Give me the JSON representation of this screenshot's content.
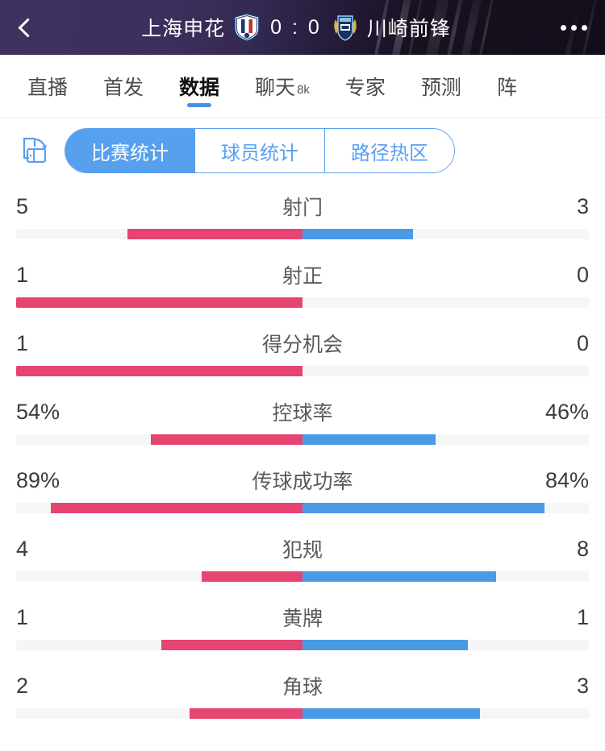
{
  "header": {
    "back_icon": "back-chevron-icon",
    "home_team": "上海申花",
    "away_team": "川崎前锋",
    "score": "0 : 0",
    "home_crest_icon": "shanghai-shenhua-crest-icon",
    "away_crest_icon": "kawasaki-frontale-crest-icon",
    "more_icon": "more-options-icon",
    "bg_color": "#2f2447",
    "bg_dark": "#130d1a"
  },
  "tabs": [
    {
      "label": "直播",
      "badge": "",
      "active": false
    },
    {
      "label": "首发",
      "badge": "",
      "active": false
    },
    {
      "label": "数据",
      "badge": "",
      "active": true
    },
    {
      "label": "聊天",
      "badge": "8k",
      "active": false
    },
    {
      "label": "专家",
      "badge": "",
      "active": false
    },
    {
      "label": "预测",
      "badge": "",
      "active": false
    },
    {
      "label": "阵",
      "badge": "",
      "active": false
    }
  ],
  "toolbar": {
    "rotate_icon": "screen-rotate-icon",
    "segments": [
      {
        "label": "比赛统计",
        "active": true
      },
      {
        "label": "球员统计",
        "active": false
      },
      {
        "label": "路径热区",
        "active": false
      }
    ]
  },
  "colors": {
    "home_bar": "#e54570",
    "away_bar": "#4a9ae6",
    "track": "#f5f6f8",
    "accent_blue": "#56a0ee"
  },
  "chart_data": {
    "type": "bar",
    "title": "比赛统计",
    "orientation": "diverging-horizontal",
    "legend": [
      {
        "name": "上海申花",
        "color": "#e54570",
        "side": "left"
      },
      {
        "name": "川崎前锋",
        "color": "#4a9ae6",
        "side": "right"
      }
    ],
    "categories": [
      "射门",
      "射正",
      "得分机会",
      "控球率",
      "传球成功率",
      "犯规",
      "黄牌",
      "角球"
    ],
    "series": [
      {
        "name": "上海申花",
        "values": [
          "5",
          "1",
          "1",
          "54%",
          "89%",
          "4",
          "1",
          "2"
        ]
      },
      {
        "name": "川崎前锋",
        "values": [
          "3",
          "0",
          "0",
          "46%",
          "84%",
          "8",
          "1",
          "3"
        ]
      }
    ],
    "rows": [
      {
        "label": "射门",
        "home": "5",
        "away": "3",
        "home_frac": 0.612,
        "away_frac": 0.386
      },
      {
        "label": "射正",
        "home": "1",
        "away": "0",
        "home_frac": 1.0,
        "away_frac": 0.0
      },
      {
        "label": "得分机会",
        "home": "1",
        "away": "0",
        "home_frac": 1.0,
        "away_frac": 0.0
      },
      {
        "label": "控球率",
        "home": "54%",
        "away": "46%",
        "home_frac": 0.53,
        "away_frac": 0.465
      },
      {
        "label": "传球成功率",
        "home": "89%",
        "away": "84%",
        "home_frac": 0.879,
        "away_frac": 0.845
      },
      {
        "label": "犯规",
        "home": "4",
        "away": "8",
        "home_frac": 0.352,
        "away_frac": 0.676
      },
      {
        "label": "黄牌",
        "home": "1",
        "away": "1",
        "home_frac": 0.493,
        "away_frac": 0.577
      },
      {
        "label": "角球",
        "home": "2",
        "away": "3",
        "home_frac": 0.394,
        "away_frac": 0.62
      }
    ]
  }
}
